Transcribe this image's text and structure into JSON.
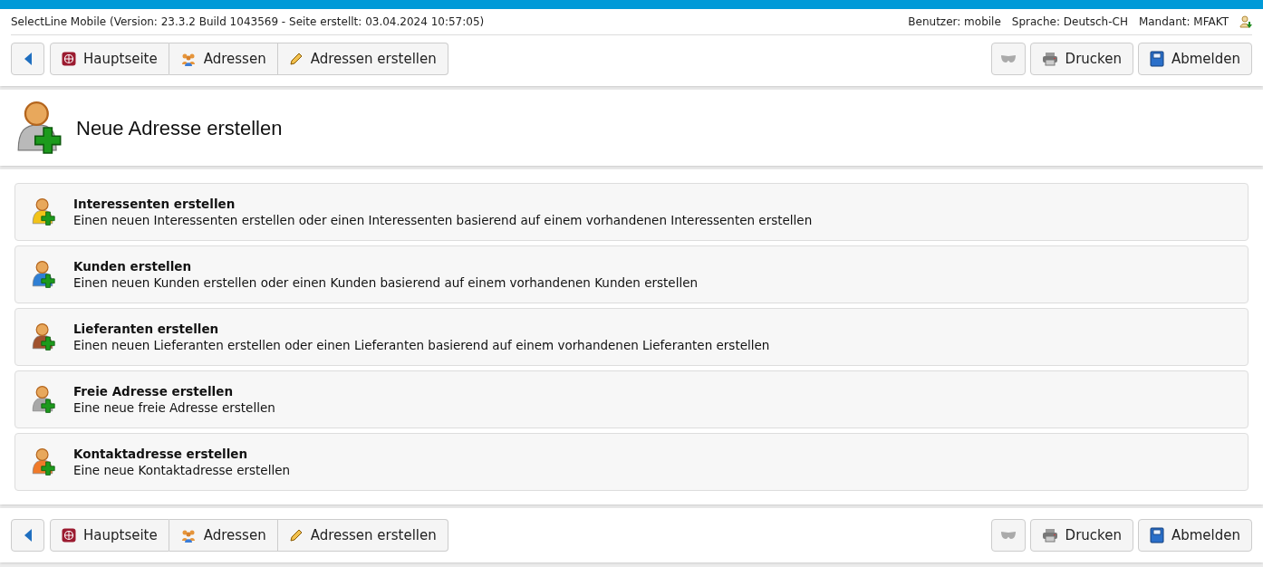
{
  "info_bar": {
    "version": "SelectLine Mobile (Version: 23.3.2 Build 1043569 - Seite erstellt: 03.04.2024 10:57:05)",
    "user": "Benutzer: mobile",
    "language": "Sprache: Deutsch-CH",
    "client": "Mandant: MFAKT"
  },
  "top_toolbar": {
    "breadcrumbs": [
      "Hauptseite",
      "Adressen",
      "Adressen erstellen"
    ],
    "buttons": [
      "Drucken",
      "Abmelden"
    ]
  },
  "header": {
    "title": "Neue Adresse erstellen"
  },
  "items": [
    {
      "title": "Interessenten erstellen",
      "description": "Einen neuen Interessenten erstellen oder einen Interessenten basierend auf einem vorhandenen Interessenten erstellen",
      "color": "#f2c318"
    },
    {
      "title": "Kunden erstellen",
      "description": "Einen neuen Kunden erstellen oder einen Kunden basierend auf einem vorhandenen Kunden erstellen",
      "color": "#2f7fd4"
    },
    {
      "title": "Lieferanten erstellen",
      "description": "Einen neuen Lieferanten erstellen oder einen Lieferanten basierend auf einem vorhandenen Lieferanten erstellen",
      "color": "#a0522d"
    },
    {
      "title": "Freie Adresse erstellen",
      "description": "Eine neue freie Adresse erstellen",
      "color": "#a8a8a8"
    },
    {
      "title": "Kontaktadresse erstellen",
      "description": "Eine neue Kontaktadresse erstellen",
      "color": "#f07a2a"
    }
  ],
  "bottom_toolbar": {
    "breadcrumbs": [
      "Hauptseite",
      "Adressen",
      "Adressen erstellen"
    ],
    "buttons": [
      "Drucken",
      "Abmelden"
    ]
  }
}
